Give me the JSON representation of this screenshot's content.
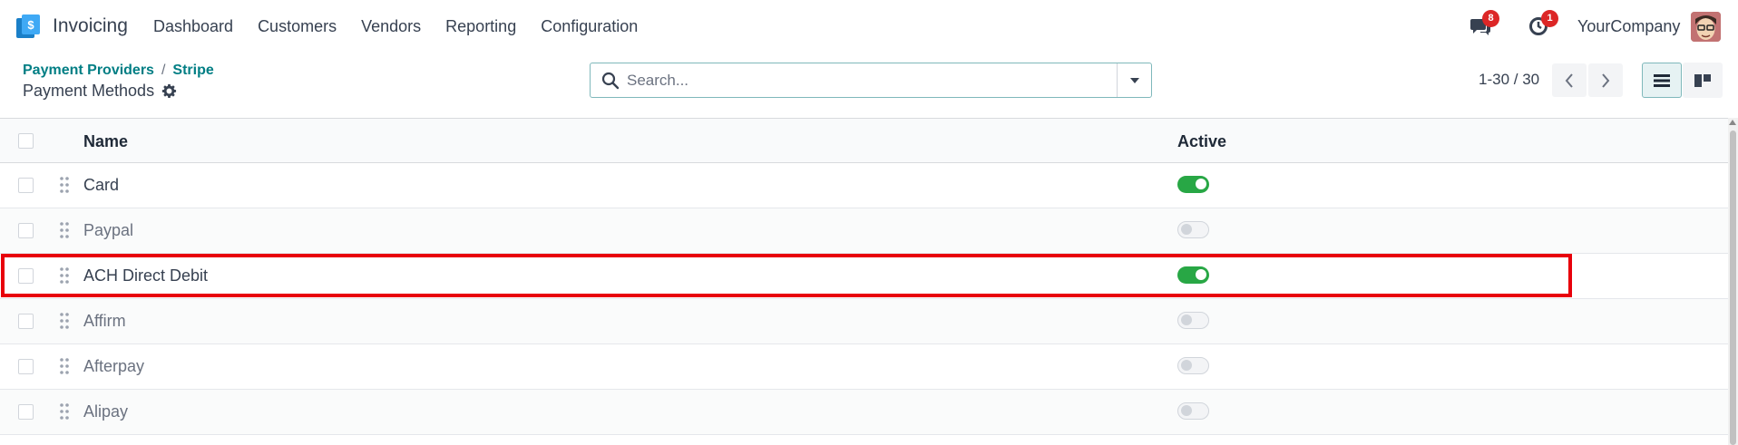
{
  "navbar": {
    "app_name": "Invoicing",
    "menu": [
      "Dashboard",
      "Customers",
      "Vendors",
      "Reporting",
      "Configuration"
    ],
    "messages_count": "8",
    "activities_count": "1",
    "company": "YourCompany"
  },
  "breadcrumb": {
    "parent": "Payment Providers",
    "separator": "/",
    "current": "Stripe"
  },
  "page_title": "Payment Methods",
  "search": {
    "placeholder": "Search...",
    "value": ""
  },
  "pager": {
    "value": "1-30 / 30"
  },
  "list": {
    "columns": {
      "name": "Name",
      "active": "Active"
    },
    "rows": [
      {
        "name": "Card",
        "active": true
      },
      {
        "name": "Paypal",
        "active": false
      },
      {
        "name": "ACH Direct Debit",
        "active": true
      },
      {
        "name": "Affirm",
        "active": false
      },
      {
        "name": "Afterpay",
        "active": false
      },
      {
        "name": "Alipay",
        "active": false
      }
    ]
  },
  "icons": {
    "app": "invoicing-app-icon",
    "messages": "chat-icon",
    "activities": "clock-icon",
    "settings": "gear-icon",
    "search": "search-icon",
    "dropdown": "caret-down-icon",
    "prev": "chevron-left-icon",
    "next": "chevron-right-icon",
    "list_view": "list-view-icon",
    "kanban_view": "kanban-view-icon",
    "drag": "drag-handle-icon"
  },
  "colors": {
    "brand_teal": "#017e84",
    "toggle_on": "#28a745",
    "highlight": "#e8000b",
    "badge": "#dc2626"
  }
}
